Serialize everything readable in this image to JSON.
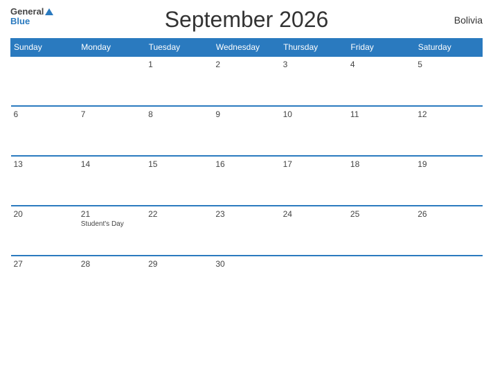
{
  "header": {
    "title": "September 2026",
    "country": "Bolivia",
    "logo_general": "General",
    "logo_blue": "Blue"
  },
  "days_of_week": [
    "Sunday",
    "Monday",
    "Tuesday",
    "Wednesday",
    "Thursday",
    "Friday",
    "Saturday"
  ],
  "weeks": [
    [
      {
        "day": "",
        "event": ""
      },
      {
        "day": "",
        "event": ""
      },
      {
        "day": "1",
        "event": ""
      },
      {
        "day": "2",
        "event": ""
      },
      {
        "day": "3",
        "event": ""
      },
      {
        "day": "4",
        "event": ""
      },
      {
        "day": "5",
        "event": ""
      }
    ],
    [
      {
        "day": "6",
        "event": ""
      },
      {
        "day": "7",
        "event": ""
      },
      {
        "day": "8",
        "event": ""
      },
      {
        "day": "9",
        "event": ""
      },
      {
        "day": "10",
        "event": ""
      },
      {
        "day": "11",
        "event": ""
      },
      {
        "day": "12",
        "event": ""
      }
    ],
    [
      {
        "day": "13",
        "event": ""
      },
      {
        "day": "14",
        "event": ""
      },
      {
        "day": "15",
        "event": ""
      },
      {
        "day": "16",
        "event": ""
      },
      {
        "day": "17",
        "event": ""
      },
      {
        "day": "18",
        "event": ""
      },
      {
        "day": "19",
        "event": ""
      }
    ],
    [
      {
        "day": "20",
        "event": ""
      },
      {
        "day": "21",
        "event": "Student's Day"
      },
      {
        "day": "22",
        "event": ""
      },
      {
        "day": "23",
        "event": ""
      },
      {
        "day": "24",
        "event": ""
      },
      {
        "day": "25",
        "event": ""
      },
      {
        "day": "26",
        "event": ""
      }
    ],
    [
      {
        "day": "27",
        "event": ""
      },
      {
        "day": "28",
        "event": ""
      },
      {
        "day": "29",
        "event": ""
      },
      {
        "day": "30",
        "event": ""
      },
      {
        "day": "",
        "event": ""
      },
      {
        "day": "",
        "event": ""
      },
      {
        "day": "",
        "event": ""
      }
    ]
  ],
  "colors": {
    "header_bg": "#2a7abf",
    "accent": "#2a7abf"
  }
}
